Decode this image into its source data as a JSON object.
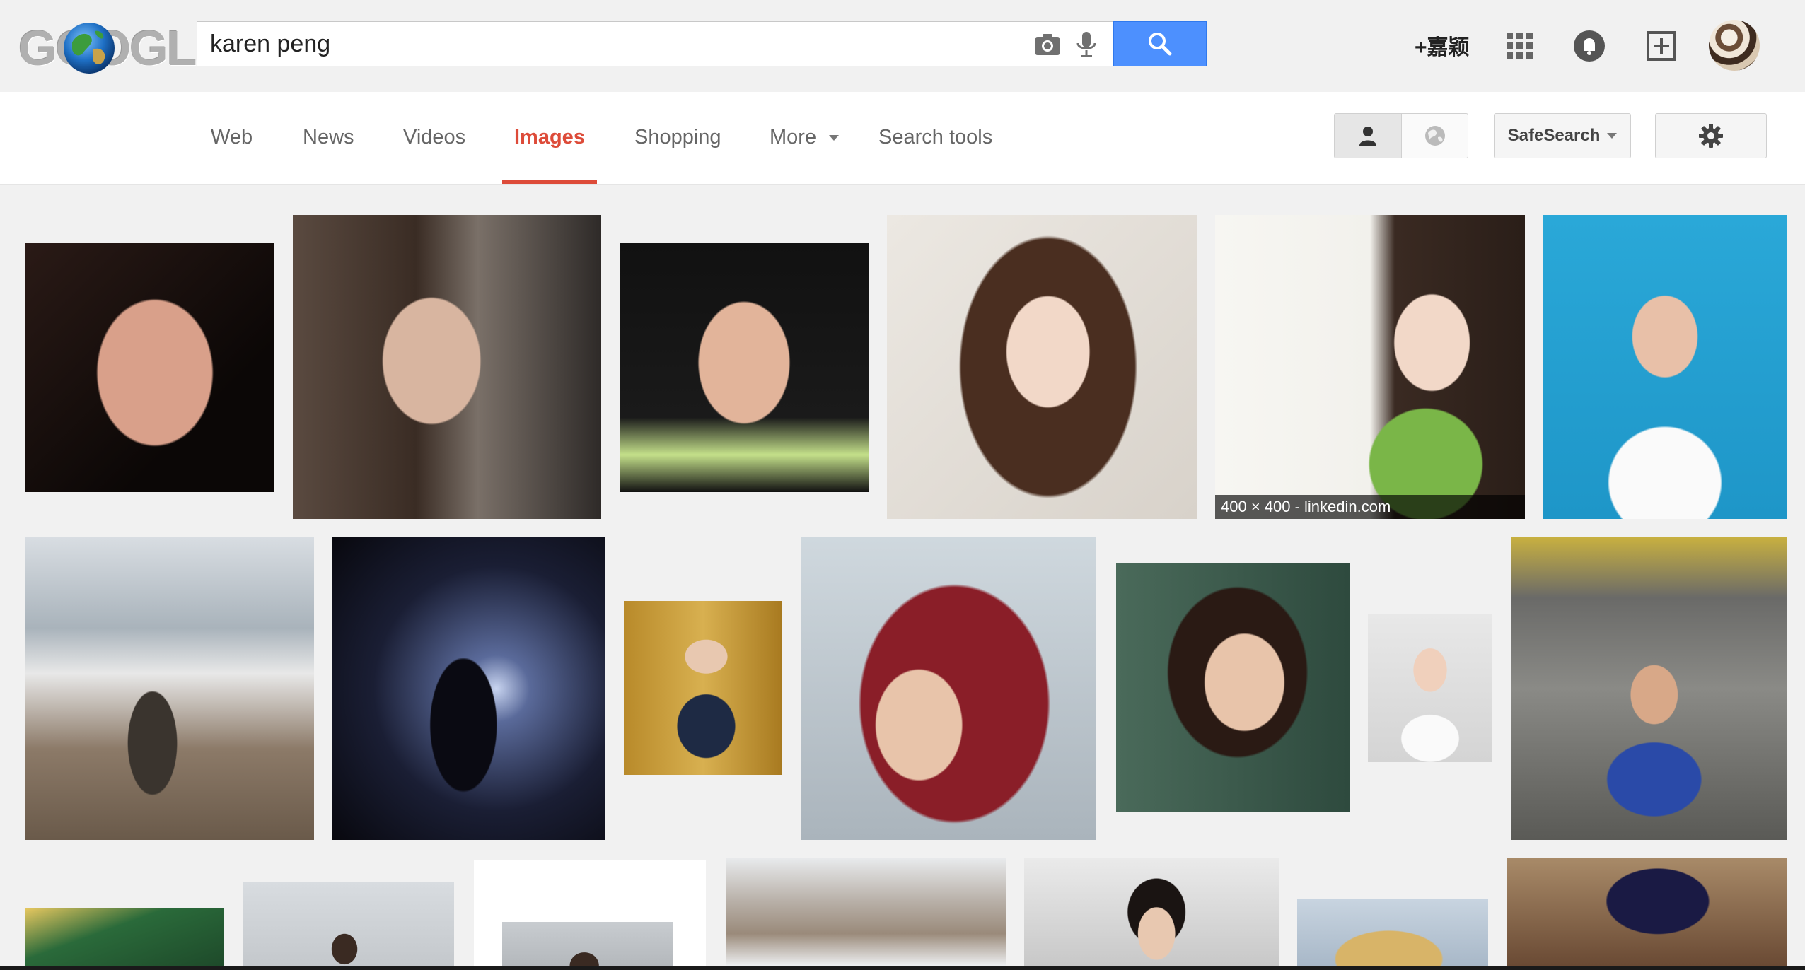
{
  "header": {
    "logo_text": "GOOGLE",
    "search_query": "karen peng",
    "plus_user": "+嘉颖"
  },
  "nav": {
    "tabs": [
      {
        "label": "Web"
      },
      {
        "label": "News"
      },
      {
        "label": "Videos"
      },
      {
        "label": "Images",
        "active": true
      },
      {
        "label": "Shopping"
      },
      {
        "label": "More"
      },
      {
        "label": "Search tools"
      }
    ],
    "safesearch_label": "SafeSearch"
  },
  "colors": {
    "accent_red": "#dd4b39",
    "search_blue": "#4d90fe"
  },
  "results": {
    "hover_caption": "400 × 400 - linkedin.com"
  }
}
